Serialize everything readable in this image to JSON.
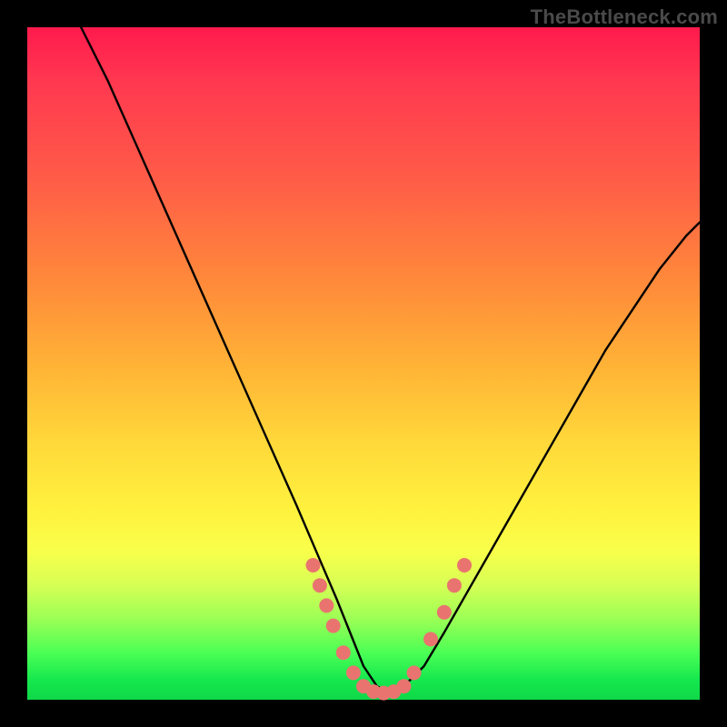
{
  "watermark": "TheBottleneck.com",
  "colors": {
    "gradient_top": "#ff1a4d",
    "gradient_mid1": "#ff8a3a",
    "gradient_mid2": "#fff23e",
    "gradient_bottom": "#0fd848",
    "curve": "#000000",
    "dots": "#e9746f",
    "frame_bg": "#000000"
  },
  "chart_data": {
    "type": "line",
    "title": "",
    "xlabel": "",
    "ylabel": "",
    "xlim": [
      0,
      100
    ],
    "ylim": [
      0,
      100
    ],
    "grid": false,
    "legend": false,
    "series": [
      {
        "name": "bottleneck-curve",
        "x": [
          8,
          12,
          16,
          20,
          24,
          28,
          32,
          36,
          40,
          43,
          46,
          48,
          50,
          52,
          54,
          56,
          59,
          62,
          66,
          70,
          74,
          78,
          82,
          86,
          90,
          94,
          98,
          100
        ],
        "y": [
          100,
          92,
          83,
          74,
          65,
          56,
          47,
          38,
          29,
          22,
          15,
          10,
          5,
          2,
          1,
          2,
          5,
          10,
          17,
          24,
          31,
          38,
          45,
          52,
          58,
          64,
          69,
          71
        ]
      }
    ],
    "markers": [
      {
        "x": 42.5,
        "y": 20
      },
      {
        "x": 43.5,
        "y": 17
      },
      {
        "x": 44.5,
        "y": 14
      },
      {
        "x": 45.5,
        "y": 11
      },
      {
        "x": 47.0,
        "y": 7
      },
      {
        "x": 48.5,
        "y": 4
      },
      {
        "x": 50.0,
        "y": 2
      },
      {
        "x": 51.5,
        "y": 1.2
      },
      {
        "x": 53.0,
        "y": 1
      },
      {
        "x": 54.5,
        "y": 1.2
      },
      {
        "x": 56.0,
        "y": 2
      },
      {
        "x": 57.5,
        "y": 4
      },
      {
        "x": 60.0,
        "y": 9
      },
      {
        "x": 62.0,
        "y": 13
      },
      {
        "x": 63.5,
        "y": 17
      },
      {
        "x": 65.0,
        "y": 20
      }
    ],
    "notes": "No axis ticks or labels are rendered in the image; values are normalized 0-100 estimates read from pixel positions. Curve shows a steep descending left branch, flat valley near x≈52-55, and a shallower ascending right branch. Salmon dots cluster along the curve around the valley (roughly x 42-65, y 1-20)."
  }
}
